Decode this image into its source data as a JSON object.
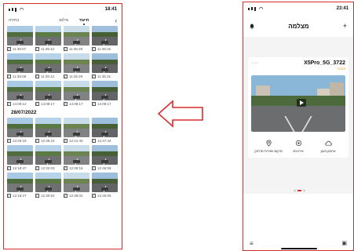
{
  "left_phone": {
    "status_time": "18:41",
    "tabs": [
      "בחירה",
      "צילום",
      "תיעוד"
    ],
    "active_tab_index": 2,
    "sections": [
      {
        "date": "",
        "rows": [
          [
            "11:35:07",
            "11:35:12",
            "11:35:28",
            "11:35:32"
          ],
          [
            "11:35:08",
            "11:35:12",
            "11:35:29",
            "11:35:31"
          ],
          [
            "14:08:12",
            "14:08:17",
            "14:08:17",
            "14:08:17"
          ]
        ]
      },
      {
        "date": "28/07/2022",
        "rows": [
          [
            "12:26:19",
            "12:35:24",
            "12:41:40",
            "12:47:44"
          ],
          [
            "12:18:47",
            "12:32:03",
            "12:39:16",
            "12:46:09"
          ],
          [
            "12:18:27",
            "12:30:52",
            "12:39:02",
            "12:45:05"
          ]
        ]
      }
    ]
  },
  "right_phone": {
    "status_time": "23:41",
    "title": "מצלמה",
    "device_name": "X5Pro_5G_3722",
    "device_status": "מחובר",
    "actions": [
      {
        "label": "מיקום ושירות מרחוק",
        "icon": "location-pin-icon"
      },
      {
        "label": "אירועים",
        "icon": "target-icon"
      },
      {
        "label": "אחסון בענן",
        "icon": "cloud-icon"
      }
    ]
  },
  "colors": {
    "frame": "#d62d2d",
    "arrow": "#d62d2d",
    "status_orange": "#f0a020"
  }
}
